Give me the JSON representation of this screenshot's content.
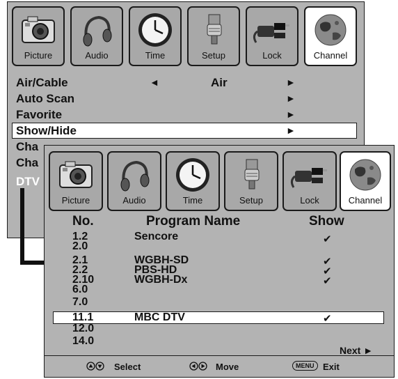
{
  "tabs": [
    {
      "label": "Picture",
      "icon": "camera-icon",
      "active": false
    },
    {
      "label": "Audio",
      "icon": "headphones-icon",
      "active": false
    },
    {
      "label": "Time",
      "icon": "clock-icon",
      "active": false
    },
    {
      "label": "Setup",
      "icon": "connector-icon",
      "active": false
    },
    {
      "label": "Lock",
      "icon": "plug-icon",
      "active": false
    },
    {
      "label": "Channel",
      "icon": "globe-icon",
      "active": true
    }
  ],
  "channel_menu": {
    "items": [
      {
        "label": "Air/Cable",
        "value": "Air",
        "left_arrow": "◄",
        "right_arrow": "►"
      },
      {
        "label": "Auto Scan",
        "value": "",
        "left_arrow": "",
        "right_arrow": "►"
      },
      {
        "label": "Favorite",
        "value": "",
        "left_arrow": "",
        "right_arrow": "►"
      },
      {
        "label": "Show/Hide",
        "value": "",
        "left_arrow": "",
        "right_arrow": "►",
        "selected": true
      },
      {
        "label": "Cha",
        "value": "",
        "left_arrow": "",
        "right_arrow": ""
      },
      {
        "label": "Cha",
        "value": "",
        "left_arrow": "",
        "right_arrow": ""
      },
      {
        "label": "DTV",
        "value": "",
        "left_arrow": "",
        "right_arrow": ""
      }
    ]
  },
  "show_hide": {
    "columns": {
      "no": "No.",
      "name": "Program Name",
      "show": "Show"
    },
    "channels": [
      {
        "no": "1.2",
        "name": "Sencore",
        "show": "✔"
      },
      {
        "no": "2.0",
        "name": "",
        "show": ""
      },
      {
        "no": "2.1",
        "name": "WGBH-SD",
        "show": "✔"
      },
      {
        "no": "2.2",
        "name": "PBS-HD",
        "show": "✔"
      },
      {
        "no": "2.10",
        "name": "WGBH-Dx",
        "show": "✔"
      },
      {
        "no": "6.0",
        "name": "",
        "show": ""
      },
      {
        "no": "7.0",
        "name": "",
        "show": ""
      },
      {
        "no": "11.1",
        "name": "MBC DTV",
        "show": "✔",
        "selected": true
      },
      {
        "no": "12.0",
        "name": "",
        "show": ""
      },
      {
        "no": "14.0",
        "name": "",
        "show": ""
      }
    ],
    "next_label": "Next ►",
    "footer": {
      "select": "Select",
      "move": "Move",
      "menu_key": "MENU",
      "exit": "Exit"
    }
  }
}
